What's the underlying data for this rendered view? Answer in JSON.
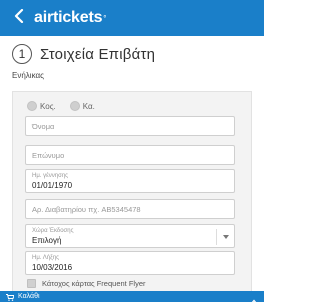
{
  "header": {
    "back_icon": "chevron-left-icon",
    "logo": "airtickets",
    "logo_mark": "°",
    "brand_color": "#1a7fc9"
  },
  "step": {
    "number": "1",
    "title": "Στοιχεία Επιβάτη"
  },
  "section": {
    "label": "Ενήλικας"
  },
  "form": {
    "gender_options": [
      "Κος.",
      "Κα."
    ],
    "first_name": {
      "placeholder": "Όνομα"
    },
    "last_name": {
      "placeholder": "Επώνυμο"
    },
    "birth_date": {
      "label": "Ημ. γέννησης",
      "value": "01/01/1970"
    },
    "passport": {
      "placeholder": "Αρ. Διαβατηρίου πχ. AB5345478"
    },
    "issuing_country": {
      "label": "Χώρα Έκδοσης",
      "value": "Επιλογή"
    },
    "expiry_date": {
      "label": "Ημ. Λήξης",
      "value": "10/03/2016"
    },
    "frequent_flyer_label": "Κάτοχος κάρτας Frequent Flyer"
  },
  "footer": {
    "cart_icon": "cart-icon",
    "cart_label": "Καλάθι",
    "expand_icon": "chevron-up-icon"
  }
}
